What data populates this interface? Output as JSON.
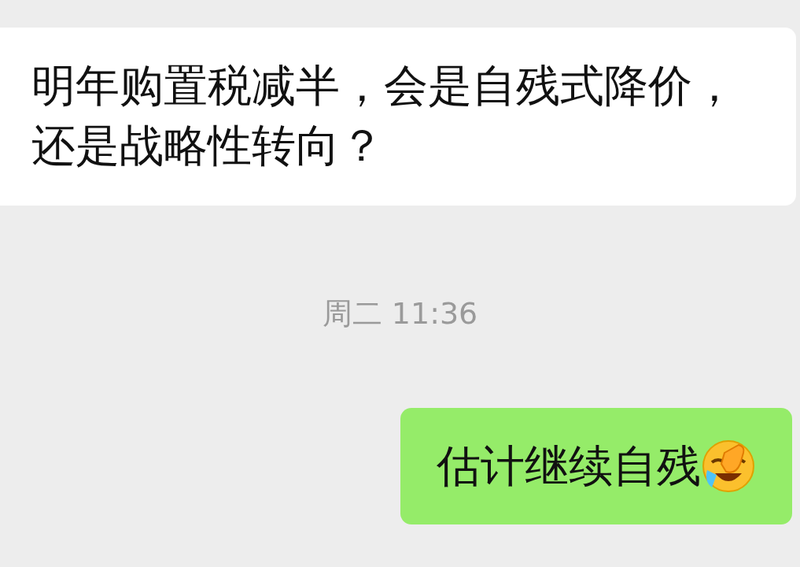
{
  "messages": [
    {
      "kind": "incoming",
      "text": "明年购置税减半，会是自残式降价，还是战略性转向？"
    },
    {
      "kind": "time",
      "text": "周二 11:36"
    },
    {
      "kind": "outgoing",
      "text": "估计继续自残"
    }
  ]
}
